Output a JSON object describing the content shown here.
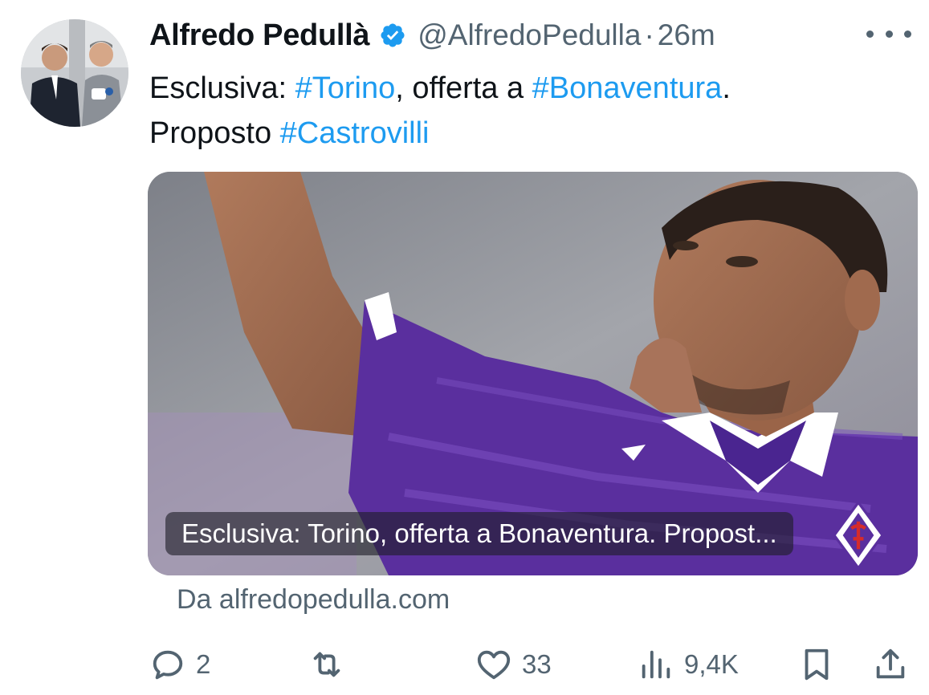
{
  "tweet": {
    "author_name": "Alfredo Pedullà",
    "handle": "@AlfredoPedulla",
    "separator": "·",
    "time": "26m",
    "text_parts": {
      "p1": "Esclusiva: ",
      "h1": "#Torino",
      "p2": ", offerta a ",
      "h2": "#Bonaventura",
      "p3": ".",
      "p4": "Proposto ",
      "h3": "#Castrovilli"
    }
  },
  "card": {
    "caption": "Esclusiva: Torino, offerta a Bonaventura. Propost...",
    "source": "Da alfredopedulla.com"
  },
  "actions": {
    "replies": "2",
    "retweets": "",
    "likes": "33",
    "views": "9,4K"
  },
  "colors": {
    "accent": "#1d9bf0",
    "text": "#0f1419",
    "muted": "#536471",
    "jersey": "#5a2f9e"
  },
  "icons": [
    "verified-badge-icon",
    "more-icon",
    "reply-icon",
    "retweet-icon",
    "like-icon",
    "views-icon",
    "bookmark-icon",
    "share-icon",
    "fiorentina-logo-icon"
  ]
}
